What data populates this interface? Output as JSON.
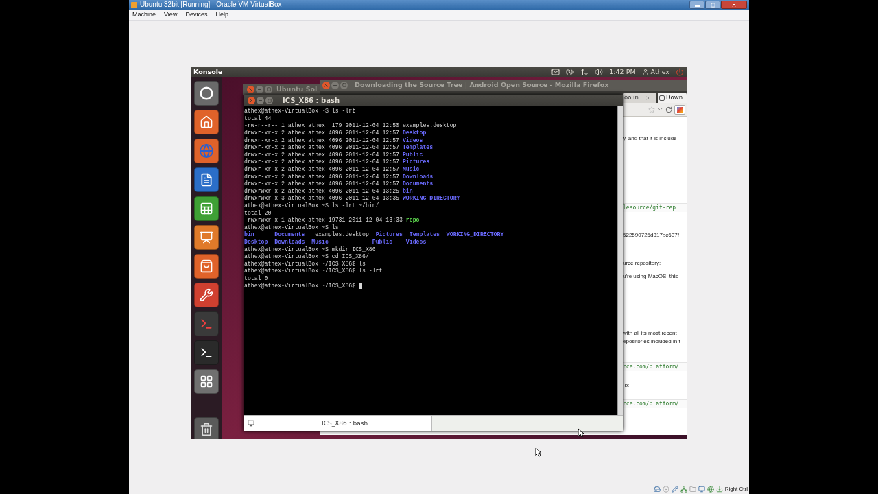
{
  "vbox": {
    "title": "Ubuntu 32bit [Running] - Oracle VM VirtualBox",
    "menu": [
      "Machine",
      "View",
      "Devices",
      "Help"
    ],
    "status_text": "Right Ctrl"
  },
  "panel": {
    "app_name": "Konsole",
    "time": "1:42 PM",
    "user": "Athex"
  },
  "back_window": {
    "title": "Ubuntu Sol"
  },
  "firefox": {
    "title": "Downloading the Source Tree | Android Open Source - Mozilla Firefox",
    "tabs": [
      {
        "label": "oo in...",
        "selected": false
      },
      {
        "label": "Down",
        "selected": true
      }
    ],
    "content": [
      {
        "kind": "text",
        "text": "y, and that it is include"
      },
      {
        "kind": "code",
        "text": "lesource/git-rep"
      },
      {
        "kind": "text",
        "text": "522590725d317bc637f"
      },
      {
        "kind": "text",
        "text": "urce repository:"
      },
      {
        "kind": "text",
        "text": "u're using MacOS, this"
      },
      {
        "kind": "text",
        "text": "with all its most recent\nepositories included in t"
      },
      {
        "kind": "code",
        "text": "rce.com/platform/"
      },
      {
        "kind": "text",
        "text": "-b:"
      },
      {
        "kind": "code",
        "text": "rce.com/platform/"
      }
    ]
  },
  "terminal": {
    "title": "ICS_X86 : bash",
    "tab": "ICS_X86 : bash",
    "lines": [
      [
        {
          "kind": "plain",
          "text": "athex@athex-VirtualBox:~$ ls -lrt"
        }
      ],
      [
        {
          "kind": "plain",
          "text": "total 44"
        }
      ],
      [
        {
          "kind": "plain",
          "text": "-rw-r--r-- 1 athex athex  179 2011-12-04 12:50 examples.desktop"
        }
      ],
      [
        {
          "kind": "plain",
          "text": "drwxr-xr-x 2 athex athex 4096 2011-12-04 12:57 "
        },
        {
          "kind": "dir",
          "text": "Desktop"
        }
      ],
      [
        {
          "kind": "plain",
          "text": "drwxr-xr-x 2 athex athex 4096 2011-12-04 12:57 "
        },
        {
          "kind": "dir",
          "text": "Videos"
        }
      ],
      [
        {
          "kind": "plain",
          "text": "drwxr-xr-x 2 athex athex 4096 2011-12-04 12:57 "
        },
        {
          "kind": "dir",
          "text": "Templates"
        }
      ],
      [
        {
          "kind": "plain",
          "text": "drwxr-xr-x 2 athex athex 4096 2011-12-04 12:57 "
        },
        {
          "kind": "dir",
          "text": "Public"
        }
      ],
      [
        {
          "kind": "plain",
          "text": "drwxr-xr-x 2 athex athex 4096 2011-12-04 12:57 "
        },
        {
          "kind": "dir",
          "text": "Pictures"
        }
      ],
      [
        {
          "kind": "plain",
          "text": "drwxr-xr-x 2 athex athex 4096 2011-12-04 12:57 "
        },
        {
          "kind": "dir",
          "text": "Music"
        }
      ],
      [
        {
          "kind": "plain",
          "text": "drwxr-xr-x 2 athex athex 4096 2011-12-04 12:57 "
        },
        {
          "kind": "dir",
          "text": "Downloads"
        }
      ],
      [
        {
          "kind": "plain",
          "text": "drwxr-xr-x 2 athex athex 4096 2011-12-04 12:57 "
        },
        {
          "kind": "dir",
          "text": "Documents"
        }
      ],
      [
        {
          "kind": "plain",
          "text": "drwxrwxr-x 2 athex athex 4096 2011-12-04 13:25 "
        },
        {
          "kind": "dir",
          "text": "bin"
        }
      ],
      [
        {
          "kind": "plain",
          "text": "drwxrwxr-x 3 athex athex 4096 2011-12-04 13:35 "
        },
        {
          "kind": "dir",
          "text": "WORKING_DIRECTORY"
        }
      ],
      [
        {
          "kind": "plain",
          "text": "athex@athex-VirtualBox:~$ ls -lrt ~/bin/"
        }
      ],
      [
        {
          "kind": "plain",
          "text": "total 20"
        }
      ],
      [
        {
          "kind": "plain",
          "text": "-rwxrwxr-x 1 athex athex 19731 2011-12-04 13:33 "
        },
        {
          "kind": "exec",
          "text": "repo"
        }
      ],
      [
        {
          "kind": "plain",
          "text": "athex@athex-VirtualBox:~$ ls"
        }
      ],
      [
        {
          "kind": "dir",
          "text": "bin"
        },
        {
          "kind": "dir",
          "text": "      Documents"
        },
        {
          "kind": "plain",
          "text": "   examples.desktop"
        },
        {
          "kind": "dir",
          "text": "  Pictures"
        },
        {
          "kind": "dir",
          "text": "  Templates"
        },
        {
          "kind": "dir",
          "text": "  WORKING_DIRECTORY"
        }
      ],
      [
        {
          "kind": "dir",
          "text": "Desktop"
        },
        {
          "kind": "dir",
          "text": "  Downloads"
        },
        {
          "kind": "dir",
          "text": "  Music"
        },
        {
          "kind": "dir",
          "text": "             Public"
        },
        {
          "kind": "dir",
          "text": "    Videos"
        }
      ],
      [
        {
          "kind": "plain",
          "text": "athex@athex-VirtualBox:~$ mkdir ICS_X86"
        }
      ],
      [
        {
          "kind": "plain",
          "text": "athex@athex-VirtualBox:~$ cd ICS_X86/"
        }
      ],
      [
        {
          "kind": "plain",
          "text": "athex@athex-VirtualBox:~/ICS_X86$ ls"
        }
      ],
      [
        {
          "kind": "plain",
          "text": "athex@athex-VirtualBox:~/ICS_X86$ ls -lrt"
        }
      ],
      [
        {
          "kind": "plain",
          "text": "total 0"
        }
      ],
      [
        {
          "kind": "plain",
          "text": "athex@athex-VirtualBox:~/ICS_X86$ "
        }
      ]
    ]
  }
}
